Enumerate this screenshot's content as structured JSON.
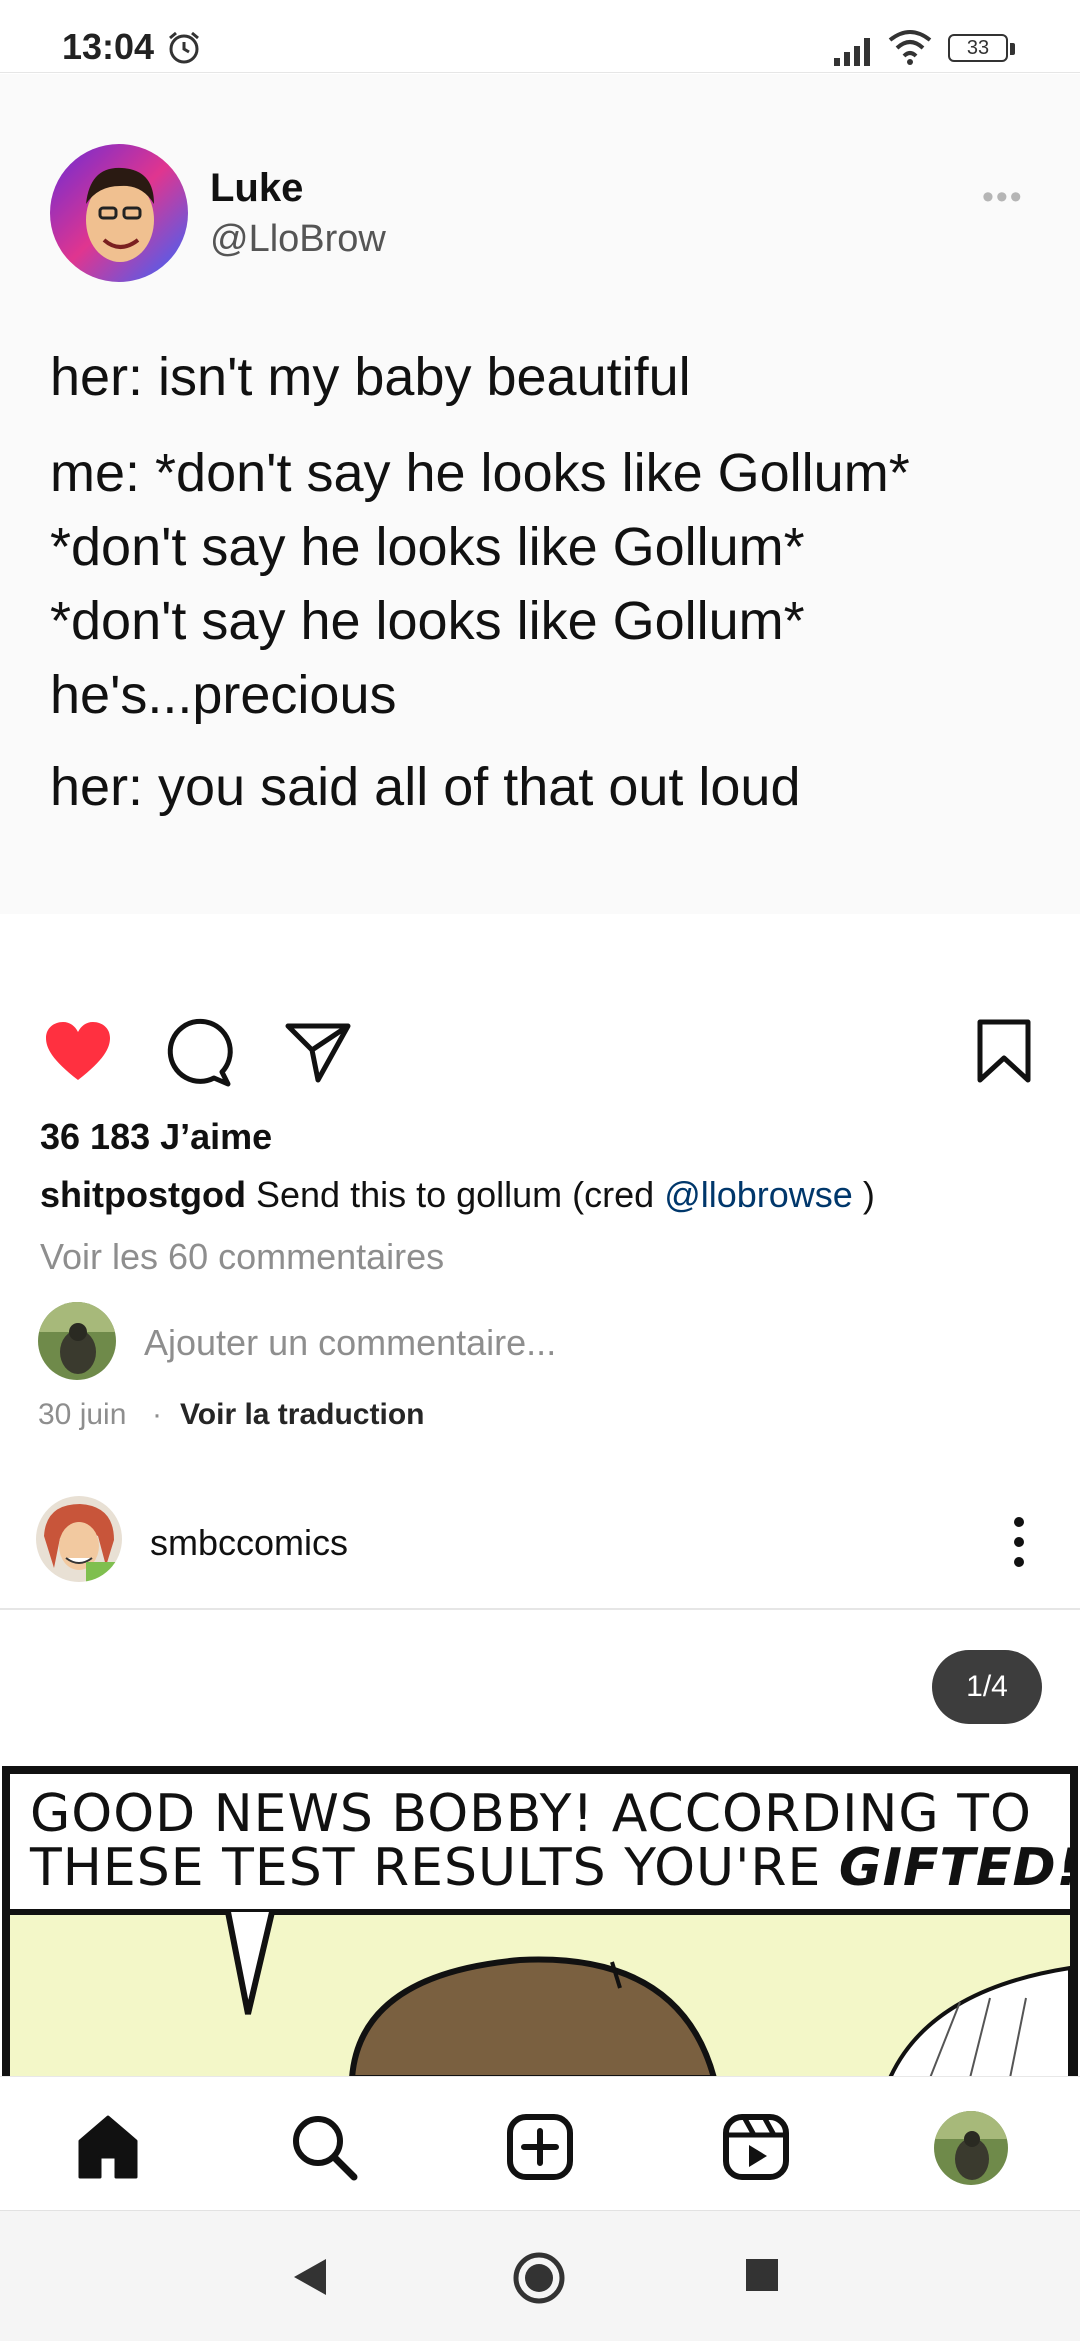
{
  "status_bar": {
    "time": "13:04",
    "battery": "33"
  },
  "tweet": {
    "name": "Luke",
    "handle": "@LloBrow",
    "lines": [
      "her: isn't my baby beautiful",
      "me: *don't say he looks like Gollum*",
      "*don't say he looks like Gollum*",
      "*don't say he looks like Gollum*",
      "he's...precious",
      "her: you said all of that out loud"
    ]
  },
  "post": {
    "likes": "36 183 J’aime",
    "caption_user": "shitpostgod",
    "caption_text": "Send this to gollum (cred ",
    "caption_mention": "@llobrowse",
    "caption_end": " )",
    "view_comments": "Voir les 60 commentaires",
    "add_comment_placeholder": "Ajouter un commentaire...",
    "date": "30 juin",
    "separator": "·",
    "translate": "Voir la traduction",
    "liked": true
  },
  "next_post": {
    "username": "smbccomics",
    "counter": "1/4",
    "comic_text_line1": "GOOD NEWS BOBBY! ACCORDING TO",
    "comic_text_line2_a": "THESE TEST RESULTS YOU'RE ",
    "comic_text_line2_b": "GIFTED!"
  },
  "colors": {
    "like_red": "#ff3040",
    "mention_blue": "#00376b",
    "muted_gray": "#8e8e8e",
    "comic_bg": "#f3f7c8"
  },
  "icons": {
    "status": [
      "alarm-icon",
      "signal-icon",
      "wifi-icon",
      "battery-icon"
    ],
    "actions": [
      "heart-icon",
      "comment-icon",
      "share-icon",
      "bookmark-icon"
    ],
    "nav": [
      "home-icon",
      "search-icon",
      "add-post-icon",
      "reels-icon",
      "profile-avatar"
    ],
    "system_nav": [
      "back-icon",
      "home-circle-icon",
      "recents-icon"
    ]
  }
}
